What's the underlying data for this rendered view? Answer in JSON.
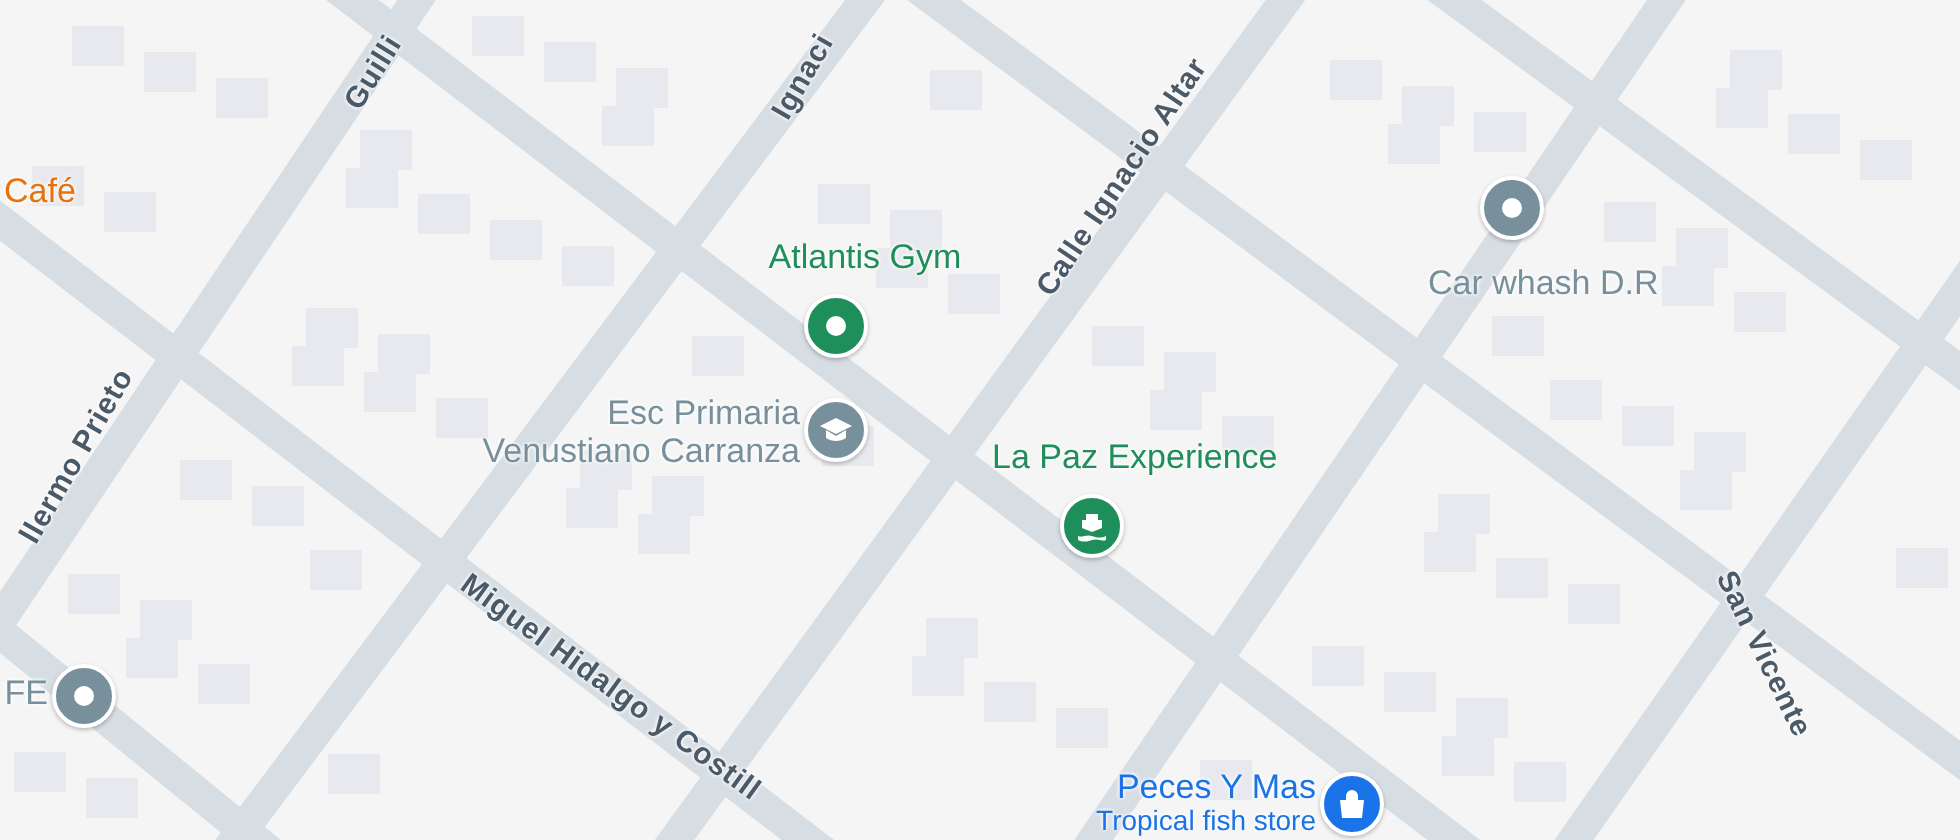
{
  "streets": [
    {
      "label": "Guilli"
    },
    {
      "label": "Ignaci"
    },
    {
      "label": "Calle Ignacio Altar"
    },
    {
      "label": "llermo Prieto"
    },
    {
      "label": "Miguel Hidalgo y Costill"
    },
    {
      "label": "San Vicente"
    }
  ],
  "places": [
    {
      "kind": "pin",
      "name": "Atlantis Gym",
      "color": "#1e8e5a"
    },
    {
      "kind": "pin",
      "name": "Esc Primaria",
      "subname": "Venustiano Carranza",
      "color": "#78909c"
    },
    {
      "kind": "pin",
      "name": "La Paz Experience",
      "color": "#1e8e5a"
    },
    {
      "kind": "pin",
      "name": "Car whash D.R",
      "color": "#78909c"
    },
    {
      "kind": "pin",
      "name": "FE",
      "color": "#78909c"
    },
    {
      "kind": "pin",
      "name": "Peces Y Mas",
      "subname": "Tropical fish store",
      "color": "#1a73e8"
    },
    {
      "kind": "text",
      "name": "Café",
      "color": "#e8710a"
    }
  ]
}
